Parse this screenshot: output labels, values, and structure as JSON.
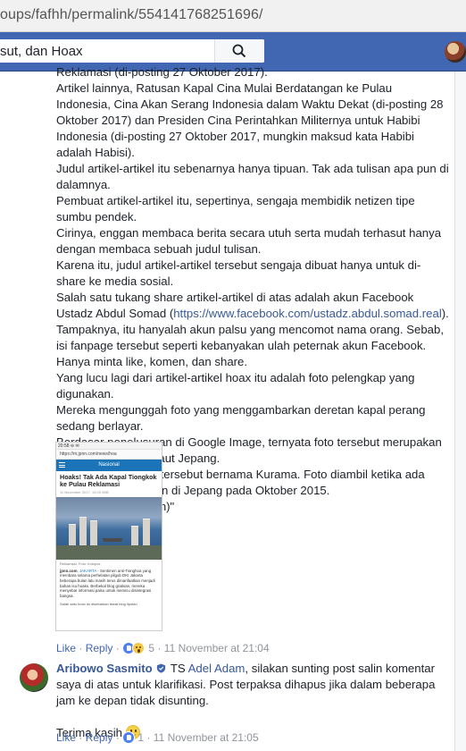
{
  "browser": {
    "url": "oups/fafhh/permalink/554141768251696/"
  },
  "fb_header": {
    "search_value": "sut, dan Hoax"
  },
  "post": {
    "paragraphs": [
      "Reklamasi (di-posting 27 Oktober 2017).",
      "Artikel lainnya, Ratusan Kapal Cina Mulai Berdatangan ke Pulau Indonesia, Cina Akan Serang Indonesia dalam Waktu Dekat (di-posting 28 Oktober 2017) dan Presiden Cina Perintahkan Militernya untuk Habibi Indonesia (di-posting 27 Oktober 2017, mungkin maksud kata Habibi adalah Habisi).",
      "Judul artikel-artikel itu sebenarnya hanya tipuan. Tak ada tulisan apa pun di dalamnya.",
      "Pembuat artikel-artikel itu, sepertinya, sengaja membidik netizen tipe sumbu pendek.",
      "Cirinya, enggan membaca berita secara utuh serta mudah terhasut hanya dengan membaca sebuah judul tulisan.",
      "Karena itu, judul artikel-artikel tersebut sengaja dibuat hanya untuk di-share ke media sosial."
    ],
    "para7_before": "Salah satu tukang share artikel-artikel di atas adalah akun Facebook Ustadz Abdul Somad (",
    "para7_link": "https://www.facebook.com/ustadz.abdul.somad.real",
    "para7_after": ").",
    "paragraphs_after": [
      "Tampaknya, itu hanyalah akun palsu yang mencomot nama orang. Sebab, isi fanpage tersebut seperti kebanyakan ulah peternak akun Facebook. Hanya minta like, komen, dan share.",
      "Yang lucu lagi dari artikel-artikel hoax itu adalah foto pelengkap yang digunakan.",
      "Mereka mengunggah foto yang menggambarkan deretan kapal perang sedang berlayar.",
      "Berdasar penelusuran di Google Image, ternyata foto tersebut merupakan armada Angkatan Laut Jepang.",
      "Kapal paling depan tersebut bernama Kurama. Foto diambil ketika ada kegiatan kemaritiman di Jepang pada Oktober 2015. (gun/eko/c10/fat/jpnn)\""
    ],
    "screenshot": {
      "status": "20:58 ⊖ ✉",
      "address": "https://m.jpnn.com/news/hoa",
      "section": "Nasional",
      "headline": "Hoaks! Tak Ada Kapal Tiongkok ke Pulau Reklamasi",
      "time": "11 November 2017, 13:00 WIB",
      "caption": "Reklamasi. Foto: Indopos",
      "body_brand": "jpnn.com",
      "body_city": ", JAKARTA",
      "body_text": " - Sentimen anti-Tionghoa yang membara selama perhelatan pilgub DKI Jakarta beberapa bulan lalu masih terus dimanfaatkan menjadi bahan isu hoaks. Berbekal blog gratisan, mereka menyebar informasi palsu untuk memicu disintegrasi bangsa.",
      "footer": "Salah satu hoax itu disebarkan lewat blog liputan"
    },
    "actions": {
      "like": "Like",
      "reply": "Reply",
      "reactions": "5",
      "time": "11 November at 21:04"
    }
  },
  "reply": {
    "author": "Aribowo Sasmito",
    "ts": "TS",
    "tagged": "Adel Adam",
    "text": ", silakan sunting post salin komentar saya di atas untuk klarifikasi. Post terpaksa dihapus jika dalam beberapa jam ke depan tidak disunting.",
    "thanks": "Terima kasih",
    "actions": {
      "like": "Like",
      "reply": "Reply",
      "reactions": "1",
      "time": "11 November at 21:05"
    }
  },
  "colors": {
    "fb_blue": "#4267b2",
    "link": "#385898",
    "meta_gray": "#90949c"
  }
}
